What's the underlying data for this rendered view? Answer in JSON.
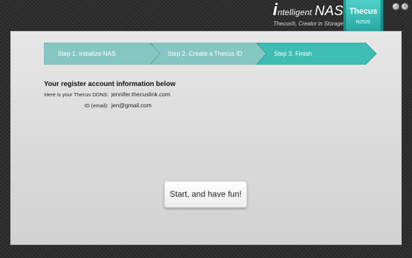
{
  "brand": {
    "title_prefix": "i",
    "title_rest": "ntelligent",
    "title_suffix": "NAS",
    "subtitle": "Thecus®, Creator in Storage",
    "badge_logo": "Thecus",
    "badge_model": "N2520"
  },
  "window_controls": [
    {
      "name": "minimize",
      "glyph": "–"
    },
    {
      "name": "close",
      "glyph": "×"
    }
  ],
  "steps": [
    {
      "label": "Step 1. Initialize NAS",
      "state": "done"
    },
    {
      "label": "Step 2. Create a Thecus ID",
      "state": "done"
    },
    {
      "label": "Step 3. Finish",
      "state": "active"
    }
  ],
  "info": {
    "title": "Your register account information below",
    "ddns_label": "Here is your Thecus DDNS:",
    "ddns_value": "jennifer.thecuslink.com",
    "email_label": "ID (email):",
    "email_value": "jen@gmail.com"
  },
  "start_button": "Start, and have fun!",
  "colors": {
    "step_done": "#86c6c2",
    "step_active": "#3ebdb5",
    "brand_teal": "#1aa39d"
  }
}
